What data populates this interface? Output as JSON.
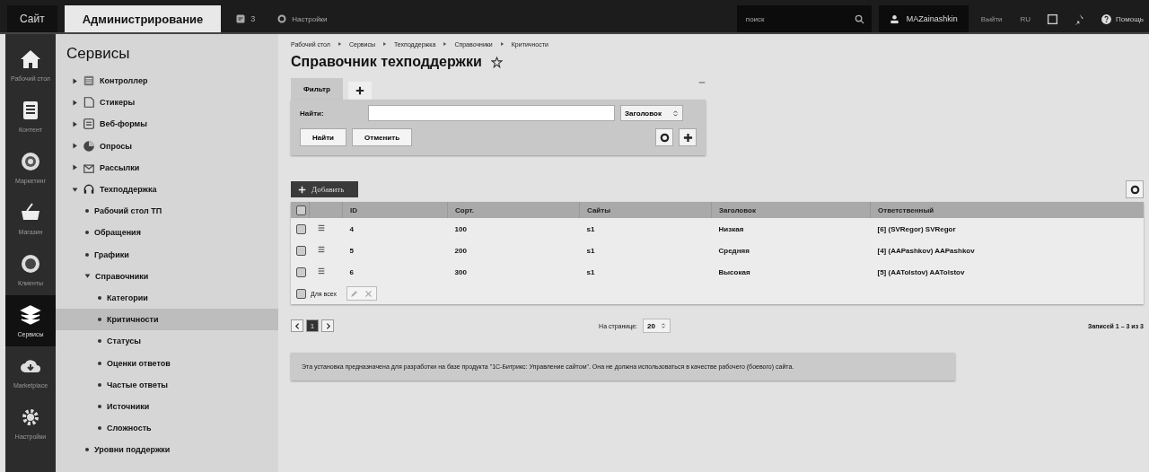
{
  "top_bar": {
    "tabs": [
      {
        "label": "Сайт",
        "selected": false
      },
      {
        "label": "Администрирование",
        "selected": true
      }
    ],
    "notifications": "3",
    "settings": "Настройки",
    "search": {
      "placeholder": "поиск"
    },
    "user": "MAZainashkin",
    "logout": "Выйти",
    "language": "RU",
    "help": "Помощь"
  },
  "sidebar": {
    "items": [
      {
        "label": "Рабочий стол",
        "selected": false
      },
      {
        "label": "Контент",
        "selected": false
      },
      {
        "label": "Маркетинг",
        "selected": false
      },
      {
        "label": "Магазин",
        "selected": false
      },
      {
        "label": "Клиенты",
        "selected": false
      },
      {
        "label": "Сервисы",
        "selected": true
      },
      {
        "label": "Marketplace",
        "selected": false
      },
      {
        "label": "Настройки",
        "selected": false
      }
    ]
  },
  "menu": {
    "title": "Сервисы",
    "items": [
      {
        "label": "Контроллер",
        "expanded": false,
        "selected": false
      },
      {
        "label": "Стикеры",
        "expanded": false,
        "selected": false
      },
      {
        "label": "Веб-формы",
        "expanded": false,
        "selected": false
      },
      {
        "label": "Опросы",
        "expanded": false,
        "selected": false
      },
      {
        "label": "Рассылки",
        "expanded": false,
        "selected": false
      },
      {
        "label": "Техподдержка",
        "expanded": true,
        "selected": false,
        "children": [
          {
            "label": "Рабочий стол ТП",
            "selected": false
          },
          {
            "label": "Обращения",
            "selected": false
          },
          {
            "label": "Графики",
            "selected": false
          },
          {
            "label": "Справочники",
            "expanded": true,
            "selected": false,
            "children": [
              {
                "label": "Категории",
                "selected": false
              },
              {
                "label": "Критичности",
                "selected": true
              },
              {
                "label": "Статусы",
                "selected": false
              },
              {
                "label": "Оценки ответов",
                "selected": false
              },
              {
                "label": "Частые ответы",
                "selected": false
              },
              {
                "label": "Источники",
                "selected": false
              },
              {
                "label": "Сложность",
                "selected": false
              }
            ]
          },
          {
            "label": "Уровни поддержки",
            "selected": false
          }
        ]
      }
    ]
  },
  "breadcrumbs": [
    "Рабочий стол",
    "Сервисы",
    "Техподдержка",
    "Справочники",
    "Критичности"
  ],
  "page_title": "Справочник техподдержки",
  "favorite": false,
  "filter": {
    "tabs": [
      {
        "label": "Фильтр",
        "selected": true
      }
    ],
    "find_label": "Найти:",
    "field_select": "Заголовок",
    "buttons": [
      "Найти",
      "Отменить"
    ]
  },
  "add_button": "Добавить",
  "table": {
    "all_checked": false,
    "columns": [
      "ID",
      "Сорт.",
      "Сайты",
      "Заголовок",
      "Ответственный"
    ],
    "rows": [
      {
        "checked": false,
        "cells": [
          "4",
          "100",
          "s1",
          "Низкая",
          "[6] (SVRegor) SVRegor"
        ]
      },
      {
        "checked": false,
        "cells": [
          "5",
          "200",
          "s1",
          "Средняя",
          "[4] (AAPashkov) AAPashkov"
        ]
      },
      {
        "checked": false,
        "cells": [
          "6",
          "300",
          "s1",
          "Высокая",
          "[5] (AATolstov) AATolstov"
        ]
      }
    ],
    "for_all": {
      "label": "Для всех",
      "checked": false
    }
  },
  "pagination": {
    "pages": [
      {
        "label": "1",
        "selected": true
      }
    ],
    "per_page_label": "На странице:",
    "per_page": "20",
    "summary": "Записей 1 – 3 из 3"
  },
  "notice": "Эта установка предназначена для разработки на базе продукта \"1С-Битрикс: Управление сайтом\". Она не должна использоваться в качестве рабочего (боевого) сайта."
}
